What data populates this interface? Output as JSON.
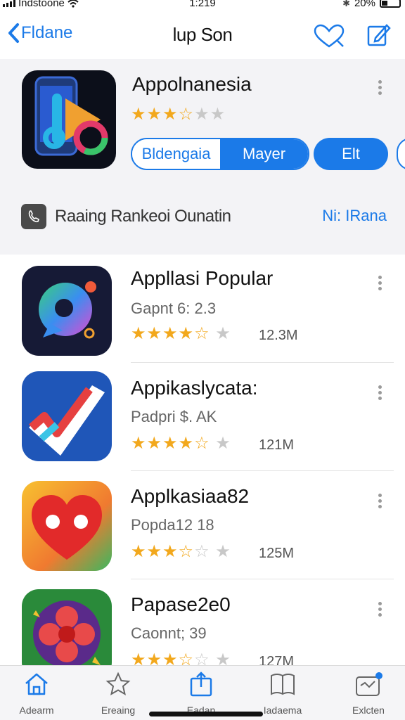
{
  "status_bar": {
    "carrier": "Indstoone",
    "time": "1:219",
    "battery": "20%"
  },
  "nav": {
    "back_label": "Fldane",
    "title": "lup Son"
  },
  "featured": {
    "name": "Appolnanesia",
    "rating": 3.5,
    "segment_left": "Bldengaia",
    "segment_right": "Mayer",
    "edit_button": "Elt"
  },
  "ranking": {
    "label": "Raaing Rankeoi Ounatin",
    "link": "Ni: IRana"
  },
  "apps": [
    {
      "name": "Appllasi Popular",
      "subtitle": "Gapnt 6: 2.3",
      "rating": 4.5,
      "count": "12.3M",
      "icon": "chat-bubble-icon"
    },
    {
      "name": "Appikaslycata:",
      "subtitle": "Padpri $. AK",
      "rating": 4.5,
      "count": "121M",
      "icon": "checkmark-bolt-icon"
    },
    {
      "name": "Applkasiaa82",
      "subtitle": "Popda12 18",
      "rating": 3.5,
      "count": "125M",
      "icon": "heart-eyes-icon"
    },
    {
      "name": "Papase2e0",
      "subtitle": "Caonnt; 39",
      "rating": 3.5,
      "count": "127M",
      "icon": "flower-icon"
    }
  ],
  "tabs": [
    {
      "label": "Adearm",
      "icon": "home-icon"
    },
    {
      "label": "Ereaing",
      "icon": "star-icon"
    },
    {
      "label": "Eadan",
      "icon": "share-icon"
    },
    {
      "label": "Iadaema",
      "icon": "book-icon"
    },
    {
      "label": "Exlcten",
      "icon": "calendar-icon"
    }
  ],
  "colors": {
    "accent": "#1b7ae8",
    "star": "#f2a81d"
  }
}
